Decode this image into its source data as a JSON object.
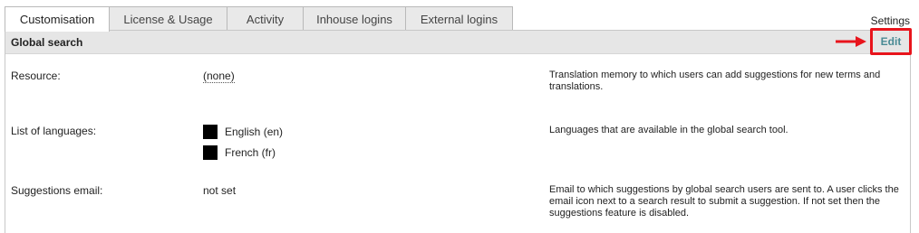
{
  "tabs": [
    {
      "label": "Customisation",
      "active": true
    },
    {
      "label": "License & Usage",
      "active": false
    },
    {
      "label": "Activity",
      "active": false
    },
    {
      "label": "Inhouse logins",
      "active": false
    },
    {
      "label": "External logins",
      "active": false
    }
  ],
  "settings_label": "Settings",
  "section": {
    "title": "Global search",
    "edit_label": "Edit"
  },
  "rows": {
    "resource": {
      "label": "Resource:",
      "value": "(none)",
      "description": "Translation memory to which users can add suggestions for new terms and translations."
    },
    "languages": {
      "label": "List of languages:",
      "items": [
        "English (en)",
        "French (fr)"
      ],
      "description": "Languages that are available in the global search tool."
    },
    "email": {
      "label": "Suggestions email:",
      "value": "not set",
      "description": "Email to which suggestions by global search users are sent to. A user clicks the email icon next to a search result to submit a suggestion. If not set then the suggestions feature is disabled."
    }
  },
  "colors": {
    "edit_link": "#4a8b95",
    "highlight": "#e8141c",
    "header_bg": "#e6e6e6"
  }
}
